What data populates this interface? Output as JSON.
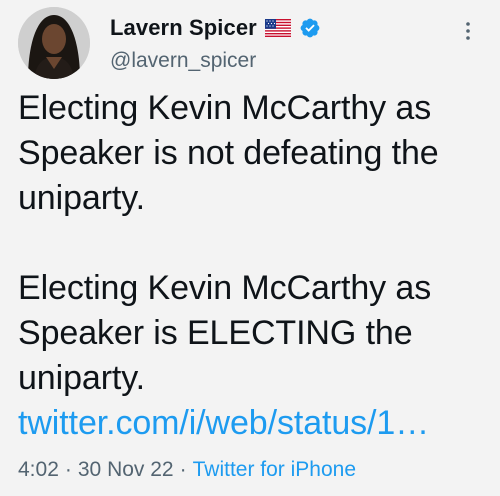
{
  "author": {
    "display_name": "Lavern Spicer",
    "handle": "@lavern_spicer",
    "flag_icon": "us-flag-icon",
    "verified_icon": "verified-badge-icon",
    "avatar": "profile-photo"
  },
  "tweet": {
    "paragraph_1": "Electing Kevin McCarthy as Speaker is not defeating the uniparty.",
    "paragraph_2_text": "Electing Kevin McCarthy as Speaker is ELECTING the uniparty.",
    "paragraph_2_link": "twitter.com/i/web/status/1…"
  },
  "meta": {
    "time": "4:02",
    "separator": "·",
    "date": "30 Nov 22",
    "client": "Twitter for iPhone"
  },
  "colors": {
    "link": "#1d9bf0",
    "verified": "#1d9bf0",
    "secondary_text": "#536471",
    "background": "#f3f3f3"
  }
}
